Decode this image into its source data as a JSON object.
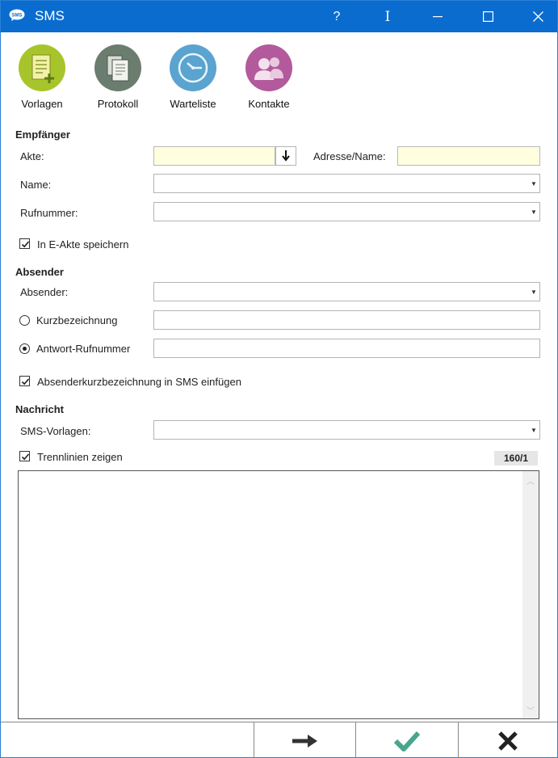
{
  "window": {
    "title": "SMS",
    "icon_text": "SMS"
  },
  "titlebar": {
    "help": "?",
    "cursor": "I"
  },
  "toolbar": {
    "items": [
      {
        "label": "Vorlagen"
      },
      {
        "label": "Protokoll"
      },
      {
        "label": "Warteliste"
      },
      {
        "label": "Kontakte"
      }
    ]
  },
  "empfaenger": {
    "title": "Empfänger",
    "akte_label": "Akte:",
    "akte_value": "",
    "adresse_label": "Adresse/Name:",
    "adresse_value": "",
    "name_label": "Name:",
    "name_value": "",
    "rufnummer_label": "Rufnummer:",
    "rufnummer_value": "",
    "eakte_label": "In E-Akte speichern",
    "eakte_checked": true
  },
  "absender": {
    "title": "Absender",
    "absender_label": "Absender:",
    "absender_value": "",
    "kurz_label": "Kurzbezeichnung",
    "kurz_value": "",
    "antwort_label": "Antwort-Rufnummer",
    "antwort_value": "",
    "einfuegen_label": "Absenderkurzbezeichnung in SMS einfügen",
    "einfuegen_checked": true
  },
  "nachricht": {
    "title": "Nachricht",
    "vorlagen_label": "SMS-Vorlagen:",
    "vorlagen_value": "",
    "trennlinien_label": "Trennlinien zeigen",
    "trennlinien_checked": true,
    "counter": "160/1",
    "body": ""
  },
  "colors": {
    "titlebar": "#0a6ccf",
    "vorlagen_icon": "#a7c52b",
    "protokoll_icon": "#6b7d6e",
    "warteliste_icon": "#5aa4cf",
    "kontakte_icon": "#b35a9c",
    "confirm": "#4aa58e"
  }
}
